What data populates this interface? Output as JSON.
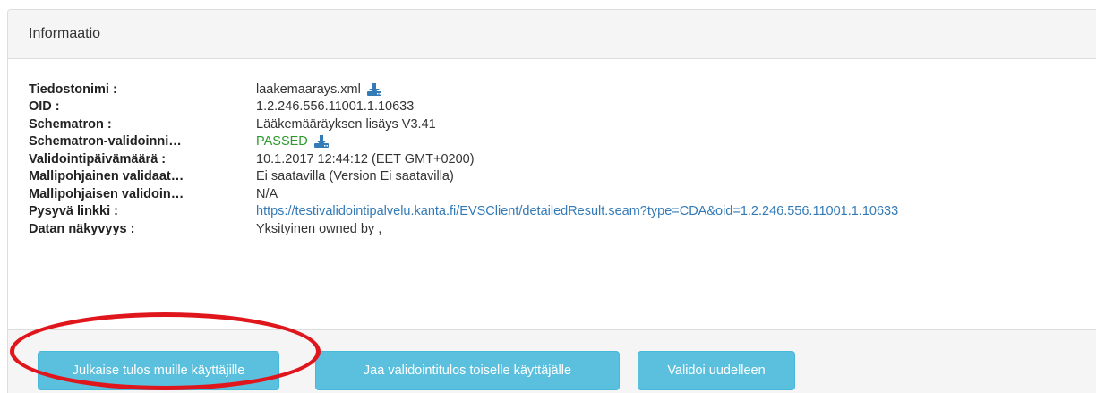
{
  "panel": {
    "heading": "Informaatio"
  },
  "info": {
    "rows": [
      {
        "label": "Tiedostonimi :",
        "value": "laakemaarays.xml",
        "icon": "download-icon"
      },
      {
        "label": "OID :",
        "value": "1.2.246.556.11001.1.10633"
      },
      {
        "label": "Schematron :",
        "value": "Lääkemääräyksen lisäys V3.41"
      },
      {
        "label": "Schematron-validoinni…",
        "value": "PASSED",
        "icon": "download-icon",
        "color": "#2e9a30"
      },
      {
        "label": "Validointipäivämäärä :",
        "value": "10.1.2017 12:44:12 (EET GMT+0200)"
      },
      {
        "label": "Mallipohjainen validaat…",
        "value": "Ei saatavilla (Version Ei saatavilla)"
      },
      {
        "label": "Mallipohjaisen validoin…",
        "value": "N/A"
      },
      {
        "label": "Pysyvä linkki :",
        "value": "https://testivalidointipalvelu.kanta.fi/EVSClient/detailedResult.seam?type=CDA&oid=1.2.246.556.11001.1.10633",
        "link": true
      },
      {
        "label": "Datan näkyvyys :",
        "value": "Yksityinen owned by ,"
      }
    ]
  },
  "footer": {
    "publish_label": "Julkaise tulos muille käyttäjille",
    "share_label": "Jaa validointitulos toiselle käyttäjälle",
    "revalidate_label": "Validoi uudelleen"
  },
  "colors": {
    "button": "#5bc0de",
    "link": "#337ab7",
    "passed": "#2e9a30",
    "annotation": "#e0161d"
  }
}
